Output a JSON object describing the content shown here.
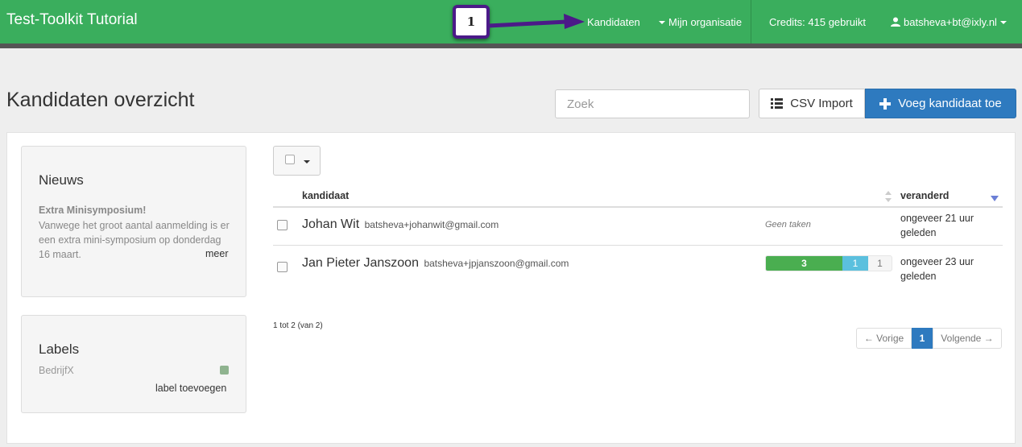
{
  "navbar": {
    "brand": "Test-Toolkit Tutorial",
    "kandidaten": "Kandidaten",
    "organisatie": "Mijn organisatie",
    "credits": "Credits: 415 gebruikt",
    "user": "batsheva+bt@ixly.nl"
  },
  "annotation": {
    "step": "1"
  },
  "header": {
    "title": "Kandidaten overzicht",
    "search_placeholder": "Zoek",
    "csv_label": "CSV Import",
    "add_label": "Voeg kandidaat toe"
  },
  "news": {
    "title": "Nieuws",
    "headline": "Extra Minisymposium!",
    "body": "Vanwege het groot aantal aanmelding is er een extra mini-symposium op donderdag 16 maart.",
    "more": "meer"
  },
  "labels": {
    "title": "Labels",
    "items": [
      {
        "name": "BedrijfX",
        "color": "#8fb38f"
      }
    ],
    "add": "label toevoegen"
  },
  "table": {
    "headers": {
      "candidate": "kandidaat",
      "changed": "veranderd"
    },
    "rows": [
      {
        "name": "Johan Wit",
        "email": "batsheva+johanwit@gmail.com",
        "tasks_text": "Geen taken",
        "changed": "ongeveer 21 uur geleden"
      },
      {
        "name": "Jan Pieter Janszoon",
        "email": "batsheva+jpjanszoon@gmail.com",
        "tasks": {
          "done": "3",
          "active": "1",
          "open": "1"
        },
        "changed": "ongeveer 23 uur geleden"
      }
    ]
  },
  "footer": {
    "count": "1 tot 2 (van 2)",
    "prev": "← Vorige",
    "page": "1",
    "next": "Volgende →"
  },
  "colors": {
    "navbar": "#3aae5d",
    "primary": "#2e7abf",
    "progress_done": "#4aae50",
    "progress_active": "#5bc0de",
    "annotation": "#4b1a88"
  }
}
